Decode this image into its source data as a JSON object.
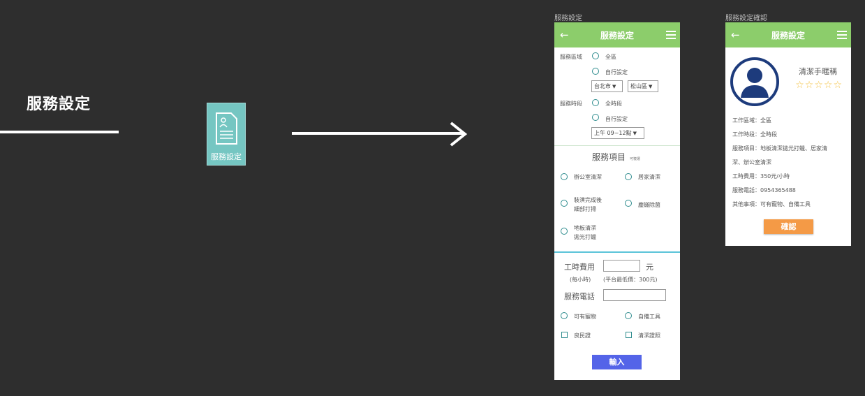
{
  "flow": {
    "title": "服務設定",
    "doc_icon_label": "服務設定"
  },
  "screen1": {
    "caption": "服務設定",
    "title": "服務設定",
    "area_label": "服務區域",
    "area_options": [
      "全區",
      "自行設定"
    ],
    "city_select": "台北市",
    "district_select": "松山區",
    "time_label": "服務時段",
    "time_options": [
      "全時段",
      "自行設定"
    ],
    "time_select": "上午 09~12點",
    "items_title": "服務項目",
    "items_note": "可複選",
    "items": [
      "辦公室清潔",
      "居家清潔",
      "裝潢完成後",
      "細部打掃",
      "塵蟎除菌",
      "地板清潔",
      "拋光打蠟"
    ],
    "fee_label": "工時費用",
    "fee_unit": "元",
    "fee_hint": "(每小時)",
    "fee_min": "(平台最低價：300元)",
    "phone_label": "服務電話",
    "extras": [
      "可有寵物",
      "自備工具"
    ],
    "checks": [
      "良民證",
      "清潔證照"
    ],
    "submit": "輸入"
  },
  "screen2": {
    "caption": "服務設定確認",
    "title": "服務設定",
    "nickname": "清潔手暱稱",
    "stars": "☆☆☆☆☆",
    "info": [
      "工作區域：全區",
      "工作時段：全時段",
      "服務項目：地板清潔拋光打蠟、居家清",
      "潔、辦公室清潔",
      "工時費用：350元/小時",
      "服務電話：0954365488",
      "其他事項：可有寵物、自備工具"
    ],
    "confirm": "確認"
  },
  "colors": {
    "background": "#2e2e2e",
    "header_green": "#8ccd6b",
    "radio_teal": "#2e8c8e",
    "submit_blue": "#5464e8",
    "confirm_orange": "#f49a46",
    "avatar_navy": "#1d3b7c",
    "star_yellow": "#f4c242"
  }
}
